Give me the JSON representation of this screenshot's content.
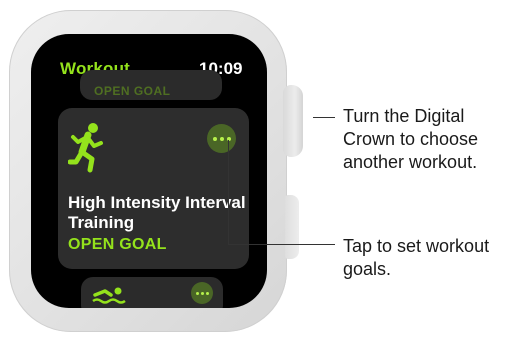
{
  "watch": {
    "header": {
      "title": "Workout",
      "time": "10:09"
    },
    "cards": {
      "previous": {
        "goal_label": "OPEN GOAL"
      },
      "current": {
        "icon": "running-figure-icon",
        "more_icon": "ellipsis-icon",
        "name": "High Intensity Interval Training",
        "goal_label": "OPEN GOAL"
      },
      "next": {
        "icon": "swimming-figure-icon",
        "more_icon": "ellipsis-icon"
      }
    }
  },
  "callouts": {
    "crown": "Turn the Digital Crown to choose another workout.",
    "goals": "Tap to set workout goals."
  },
  "colors": {
    "accent_green": "#94e21c",
    "button_green_bg": "#4a6626",
    "screen_bg": "#000000",
    "card_bg": "#2d2d2d"
  }
}
